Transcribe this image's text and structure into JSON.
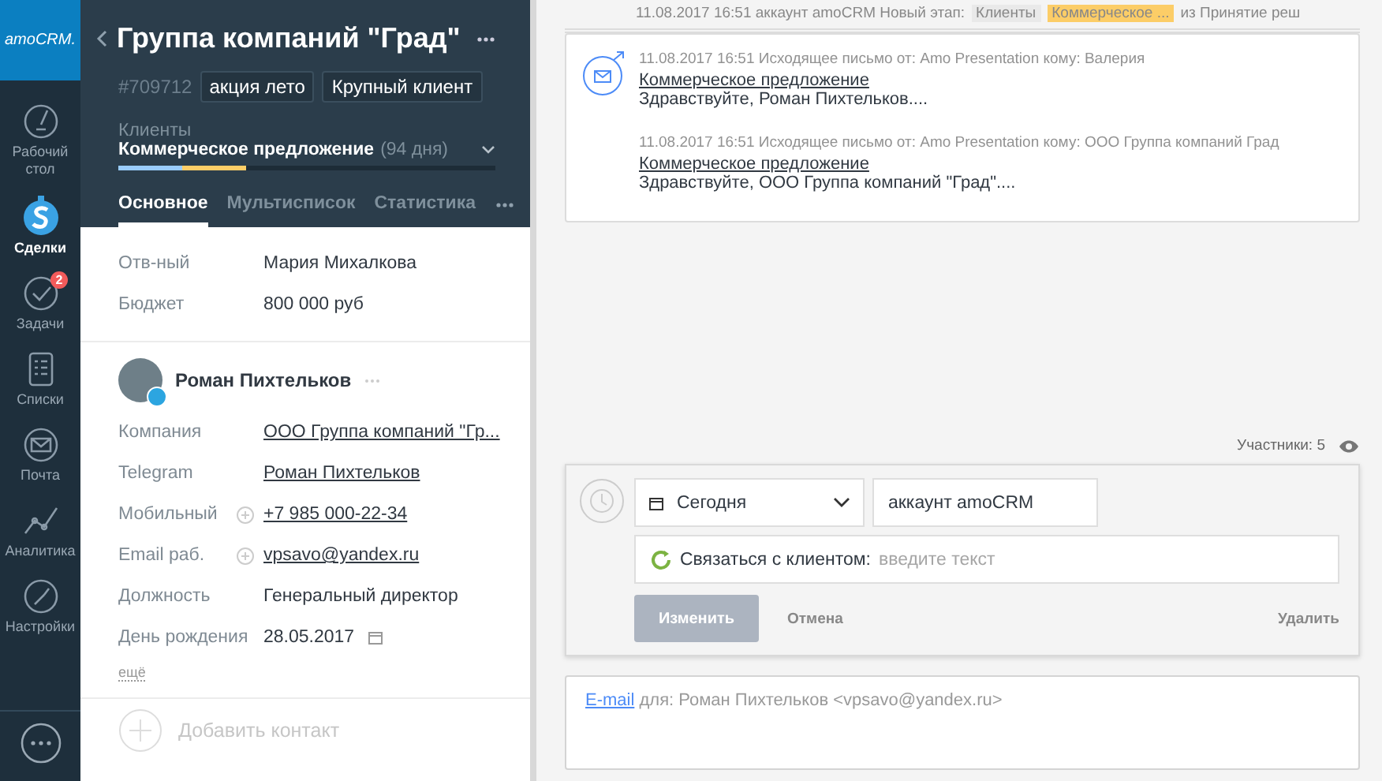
{
  "nav": {
    "logo": "amoCRM.",
    "items": [
      {
        "label": "Рабочий стол",
        "selected": false
      },
      {
        "label": "Сделки",
        "selected": true
      },
      {
        "label": "Задачи",
        "selected": false,
        "badge": "2"
      },
      {
        "label": "Списки",
        "selected": false
      },
      {
        "label": "Почта",
        "selected": false
      },
      {
        "label": "Аналитика",
        "selected": false
      },
      {
        "label": "Настройки",
        "selected": false
      }
    ]
  },
  "card": {
    "title": "Группа компаний \"Град\"",
    "id": "#709712",
    "tags": [
      "акция лето",
      "Крупный клиент"
    ],
    "pipeline": "Клиенты",
    "stage": "Коммерческое предложение",
    "stage_days": "(94 дня)",
    "level": 0.34,
    "tabs": [
      {
        "label": "Основное",
        "selected": true
      },
      {
        "label": "Мультисписок",
        "selected": false
      },
      {
        "label": "Статистика",
        "selected": false
      }
    ],
    "fields": [
      {
        "label": "Отв-ный",
        "value": "Мария Михалкова",
        "kind": "text"
      },
      {
        "label": "Бюджет",
        "value": "800 000 руб",
        "kind": "text"
      }
    ],
    "contact": {
      "name": "Роман Пихтельков",
      "fields": [
        {
          "label": "Компания",
          "value": "ООО Группа компаний \"Гр...",
          "kind": "link"
        },
        {
          "label": "Telegram",
          "value": "Роман Пихтельков",
          "kind": "link"
        },
        {
          "label": "Мобильный",
          "value": "+7 985 000-22-34",
          "kind": "addable_link"
        },
        {
          "label": "Email раб.",
          "value": "vpsavo@yandex.ru",
          "kind": "addable_link"
        },
        {
          "label": "Должность",
          "value": "Генеральный директор",
          "kind": "text"
        },
        {
          "label": "День рождения",
          "value": "28.05.2017",
          "kind": "date"
        }
      ],
      "more": "ещё"
    },
    "add_contact": "Добавить контакт"
  },
  "feed": {
    "top_line": {
      "text": "11.08.2017 16:51 аккаунт amoCRM Новый этап:",
      "from": "Клиенты",
      "to": "Коммерческое ...",
      "rest": "из Принятие реш"
    },
    "mails": [
      {
        "meta": "11.08.2017 16:51 Исходящее письмо от: Amo Presentation кому: Валерия",
        "subject": "Коммерческое предложение",
        "preview": "Здравствуйте, Роман Пихтельков...."
      },
      {
        "meta": "11.08.2017 16:51 Исходящее письмо от: Amo Presentation кому: ООО Группа компаний  Град",
        "subject": "Коммерческое предложение",
        "preview": "Здравствуйте, ООО Группа компаний \"Град\"...."
      }
    ],
    "participants": "Участники: 5",
    "task": {
      "date": "Сегодня",
      "user": "аккаунт amoCRM",
      "type": "Связаться с клиентом:",
      "placeholder": "введите текст",
      "buttons": {
        "save": "Изменить",
        "cancel": "Отмена",
        "delete": "Удалить"
      }
    },
    "composer": {
      "link": "E-mail",
      "text": "для: Роман Пихтельков <vpsavo@yandex.ru>"
    }
  }
}
